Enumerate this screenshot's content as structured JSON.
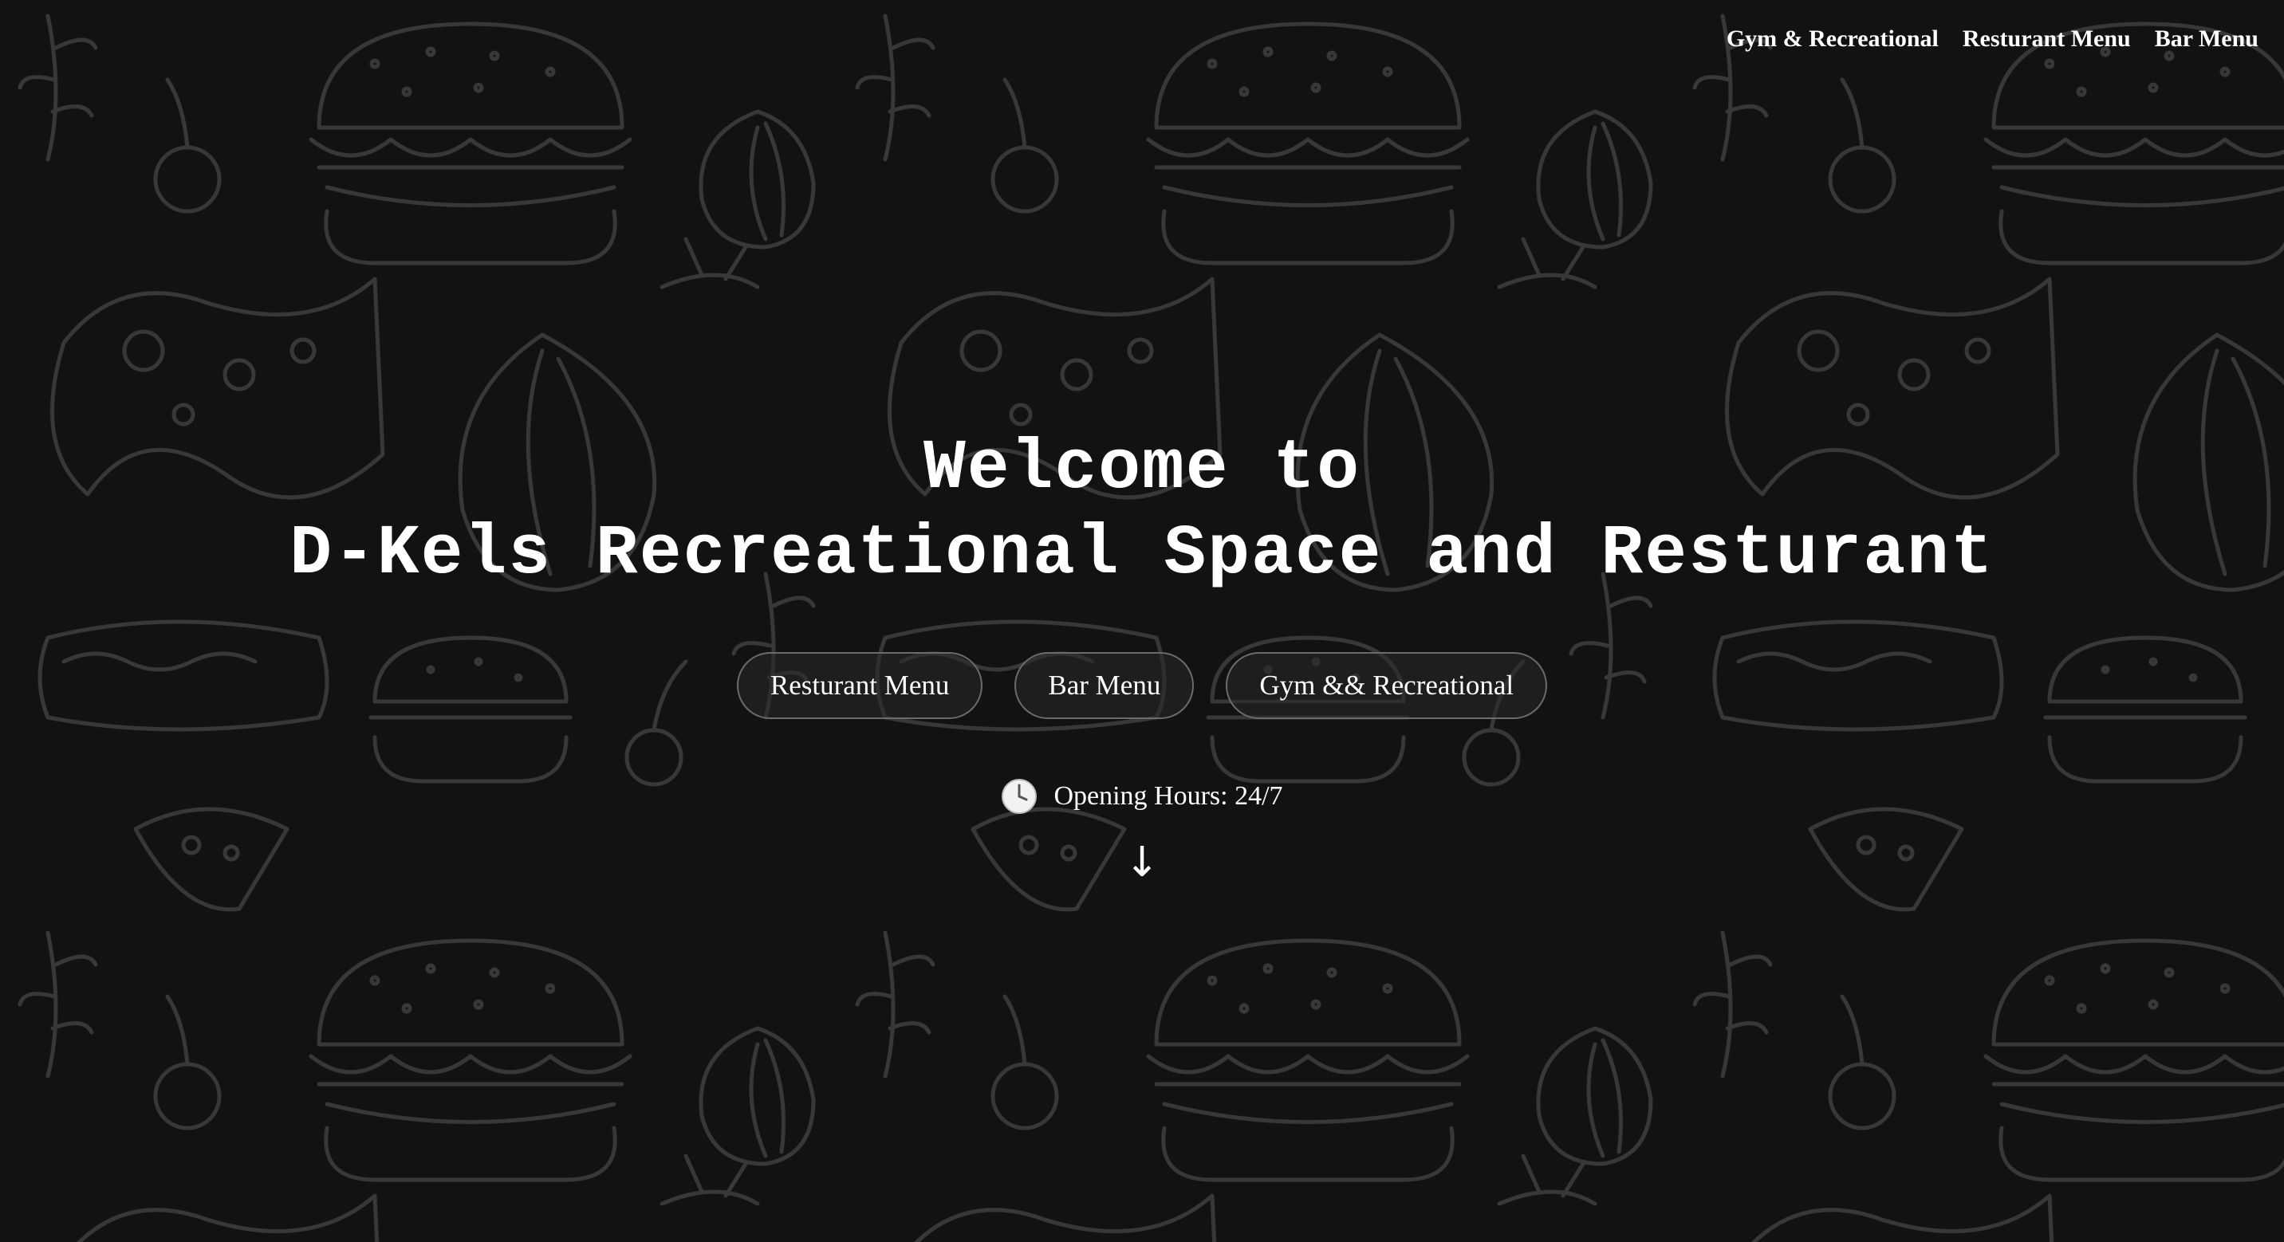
{
  "nav": {
    "items": [
      {
        "label": "Gym & Recreational"
      },
      {
        "label": "Resturant Menu"
      },
      {
        "label": "Bar Menu"
      }
    ]
  },
  "hero": {
    "title_line1": "Welcome to",
    "title_line2": "D-Kels Recreational Space and Resturant"
  },
  "buttons": [
    {
      "label": "Resturant Menu"
    },
    {
      "label": "Bar Menu"
    },
    {
      "label": "Gym && Recreational"
    }
  ],
  "hours": {
    "icon": "clock-icon",
    "text": "Opening Hours: 24/7"
  },
  "scroll": {
    "icon": "down-arrow-icon",
    "glyph": "↓"
  },
  "background": {
    "pattern": "food-doodle-pattern",
    "color": "#121212",
    "doodle_color": "#3a3a3a"
  }
}
